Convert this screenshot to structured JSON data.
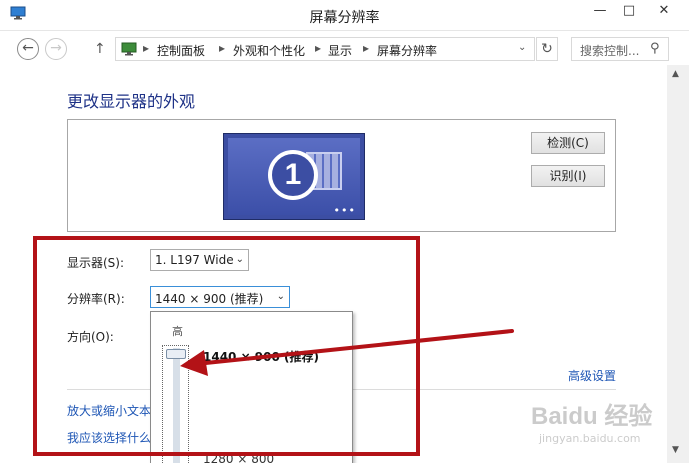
{
  "window": {
    "title": "屏幕分辨率",
    "minimize": "—",
    "maximize": "□",
    "close": "✕"
  },
  "nav": {
    "back": "←",
    "forward": "→",
    "up": "↑",
    "breadcrumbs": [
      "控制面板",
      "外观和个性化",
      "显示",
      "屏幕分辨率"
    ],
    "separator": "▸",
    "dropdown": "⌄",
    "refresh": "↻",
    "search_placeholder": "搜索控制...",
    "search_icon": "⚲"
  },
  "main": {
    "title": "更改显示器的外观",
    "monitor_number": "1",
    "monitor_dots": "•••",
    "detect_button": "检测(C)",
    "identify_button": "识别(I)",
    "display_label": "显示器(S):",
    "display_value": "1. L197 Wide",
    "resolution_label": "分辨率(R):",
    "resolution_value": "1440 × 900 (推荐)",
    "orientation_label": "方向(O):",
    "select_arrow": "⌄",
    "advanced_link": "高级设置",
    "link_text_size": "放大或缩小文本",
    "link_which": "我应该选择什么"
  },
  "resolution_dropdown": {
    "high_label": "高",
    "top_option": "1440 × 900 (推荐)",
    "bottom_option": "1280 × 800"
  },
  "scrollbar": {
    "up": "▲",
    "down": "▼"
  },
  "watermark": {
    "line1": "Baidu 经验",
    "line2": "jingyan.baidu.com"
  },
  "colors": {
    "annotation_red": "#b31217",
    "link_blue": "#1e56b5",
    "title_blue": "#1e3287",
    "monitor_blue": "#3c4ea3"
  }
}
